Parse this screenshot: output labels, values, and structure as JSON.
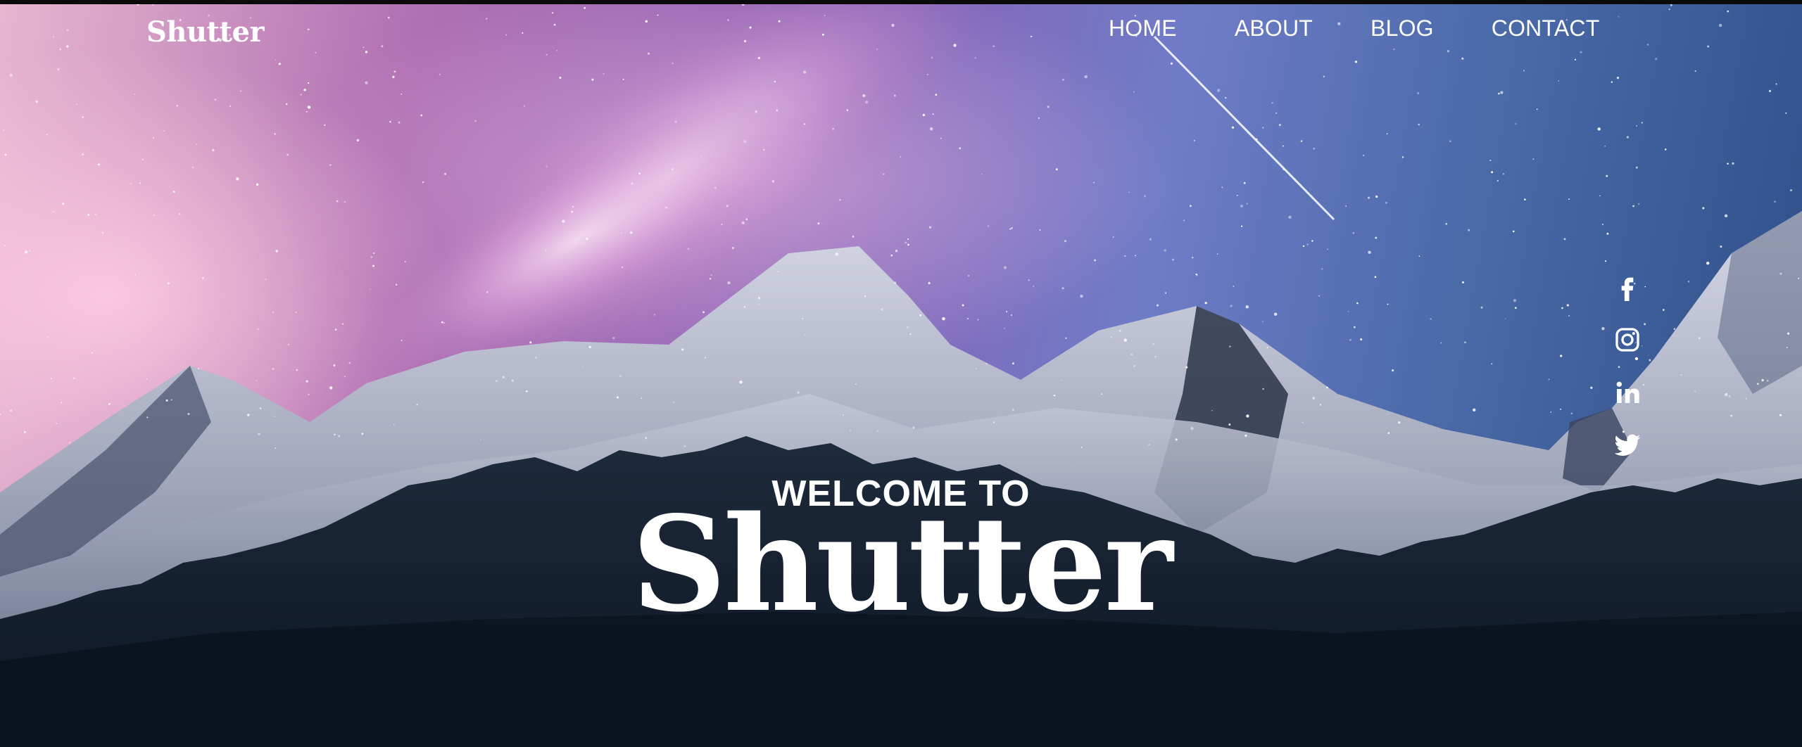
{
  "header": {
    "logo": "Shutter",
    "nav": {
      "home": "HOME",
      "about": "ABOUT",
      "blog": "BLOG",
      "contact": "CONTACT"
    }
  },
  "social": {
    "icons": [
      "facebook-icon",
      "instagram-icon",
      "linkedin-icon",
      "twitter-icon"
    ]
  },
  "hero": {
    "eyebrow": "WELCOME TO",
    "title": "Shutter"
  },
  "colors": {
    "text": "#ffffff",
    "sky_left": "#e7b6cf",
    "sky_right": "#2c4d86",
    "forest": "#0e1826"
  }
}
